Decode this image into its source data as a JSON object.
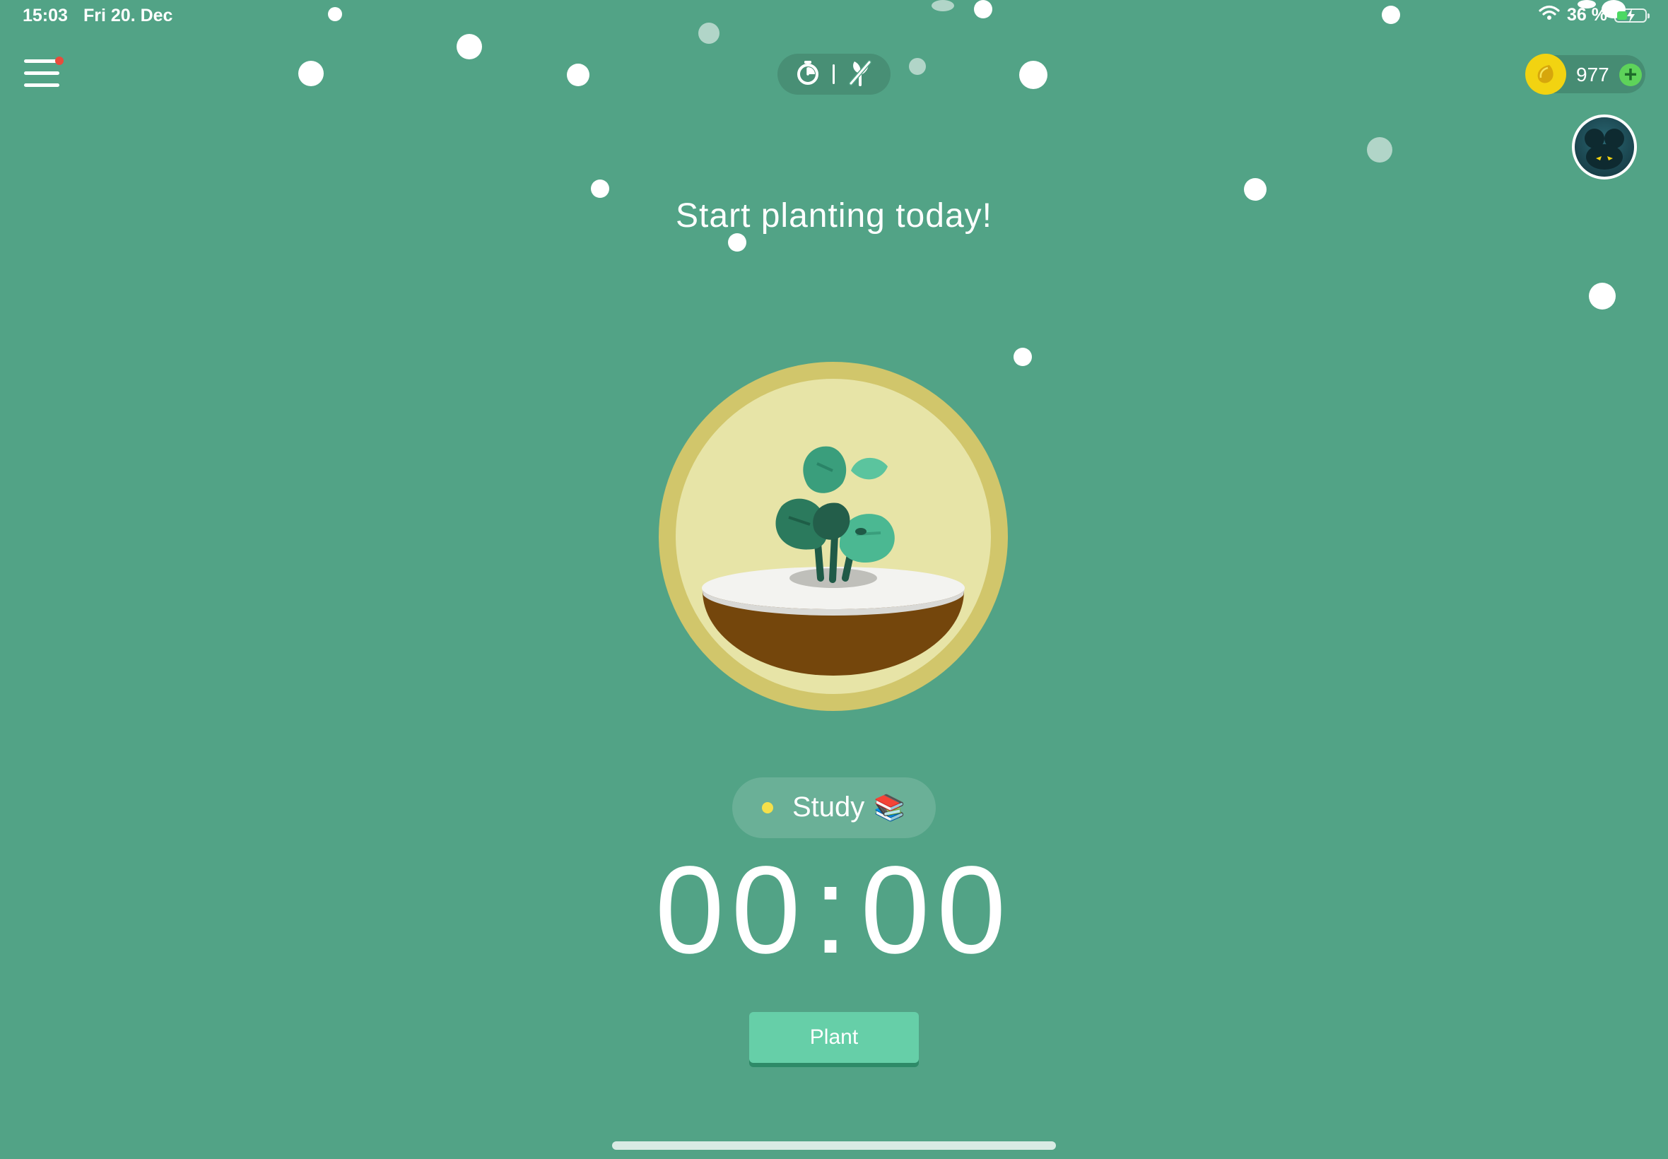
{
  "status_bar": {
    "time": "15:03",
    "date": "Fri 20. Dec",
    "battery_percent": "36 %",
    "battery_level": 0.36
  },
  "header": {
    "coins": "977"
  },
  "main": {
    "headline": "Start planting today!",
    "tag": {
      "label": "Study",
      "emoji": "📚",
      "color": "#f5e04a"
    },
    "timer": {
      "minutes": "00",
      "seconds": "00",
      "separator": ":"
    },
    "plant_button_label": "Plant"
  },
  "icons": {
    "menu": "hamburger-menu-icon",
    "stopwatch": "stopwatch-icon",
    "deep_focus_off": "no-plant-icon",
    "coin": "coin-icon",
    "add": "plus-icon",
    "avatar": "avatar-icon",
    "wifi": "wifi-icon",
    "battery": "battery-charging-icon"
  },
  "colors": {
    "background": "#52a386",
    "plant_button": "#66cfa8",
    "coin": "#f2d311",
    "notification": "#e74c3c"
  }
}
